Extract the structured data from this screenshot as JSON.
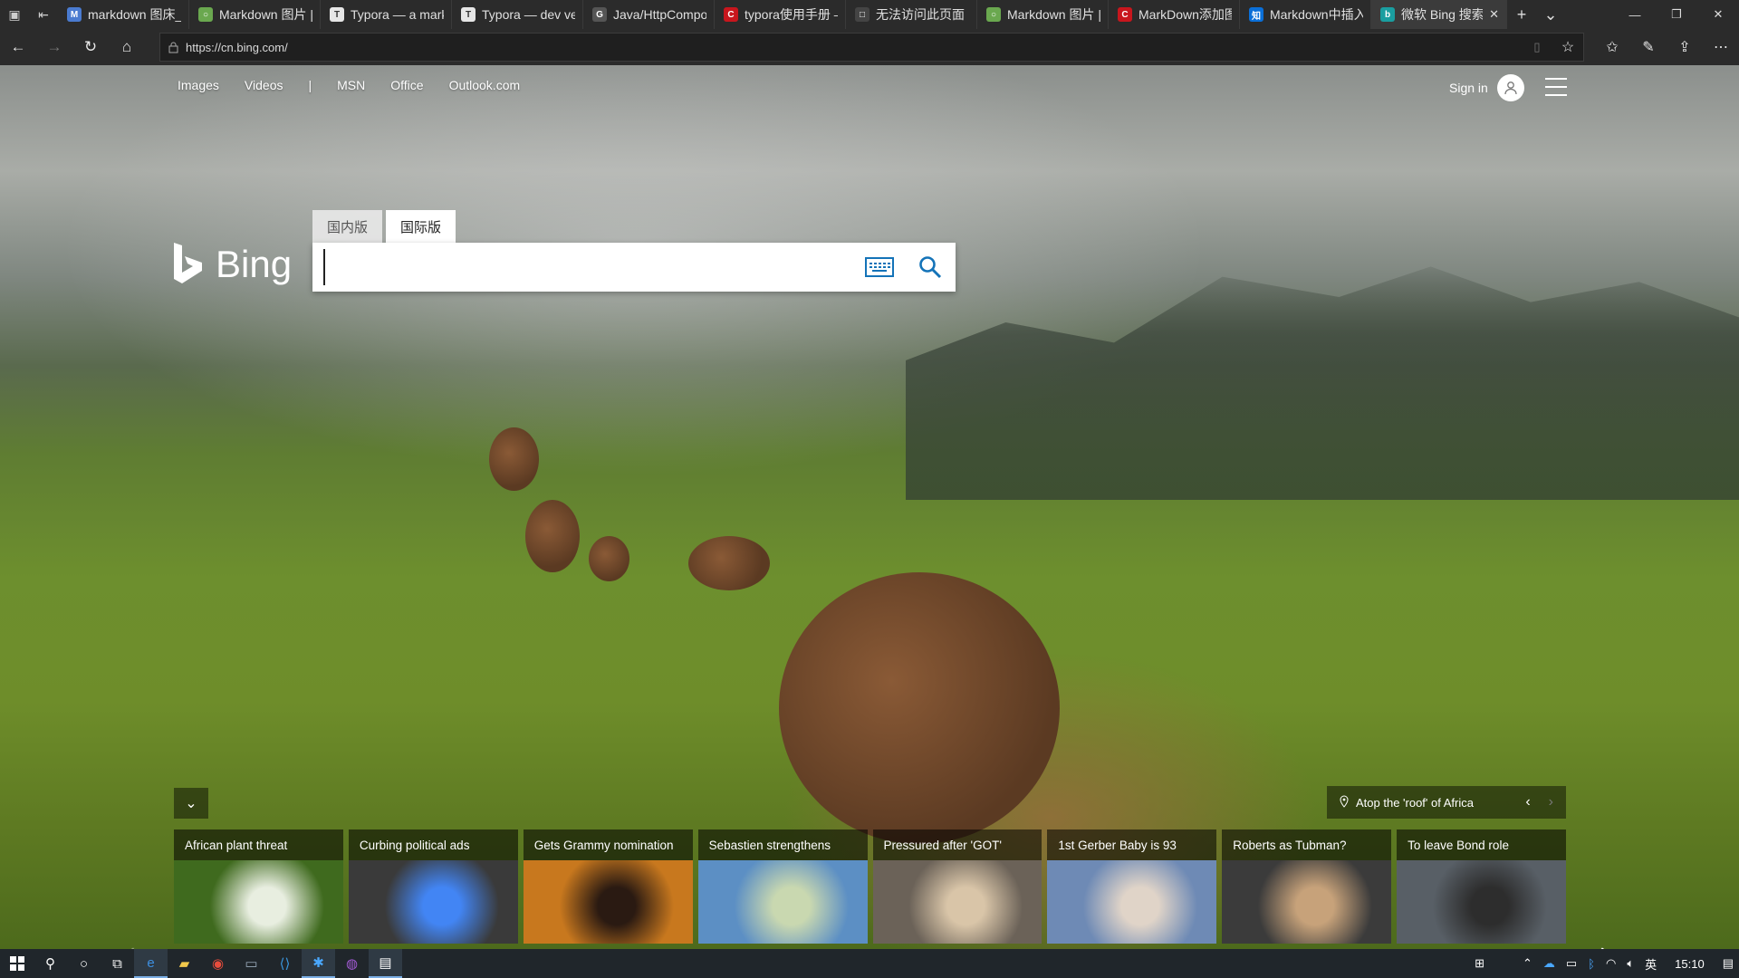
{
  "browser": {
    "tabs": [
      {
        "title": "markdown 图床_B",
        "favicon_color": "#4a7bd0",
        "favicon_char": "M"
      },
      {
        "title": "Markdown 图片 |:",
        "favicon_color": "#6aa84f",
        "favicon_char": "○"
      },
      {
        "title": "Typora — a markc",
        "favicon_color": "#e6e6e6",
        "favicon_char": "T"
      },
      {
        "title": "Typora — dev vers",
        "favicon_color": "#e6e6e6",
        "favicon_char": "T"
      },
      {
        "title": "Java/HttpCompon",
        "favicon_color": "#555555",
        "favicon_char": "G"
      },
      {
        "title": "typora使用手册 —",
        "favicon_color": "#c8161d",
        "favicon_char": "C"
      },
      {
        "title": "无法访问此页面",
        "favicon_color": "#444444",
        "favicon_char": "□"
      },
      {
        "title": "Markdown 图片 |:",
        "favicon_color": "#6aa84f",
        "favicon_char": "○"
      },
      {
        "title": "MarkDown添加图",
        "favicon_color": "#c8161d",
        "favicon_char": "C"
      },
      {
        "title": "Markdown中插入|",
        "favicon_color": "#0a6fd8",
        "favicon_char": "知"
      },
      {
        "title": "微软 Bing 搜索",
        "favicon_color": "#1a9ea0",
        "favicon_char": "b",
        "active": true
      }
    ],
    "url": "https://cn.bing.com/"
  },
  "bing": {
    "nav": [
      "Images",
      "Videos",
      "|",
      "MSN",
      "Office",
      "Outlook.com"
    ],
    "signin": "Sign in",
    "logo_text": "Bing",
    "search_tabs": [
      "国内版",
      "国际版"
    ],
    "search_value": "",
    "location_caption": "Atop the 'roof' of Africa",
    "carousel": [
      {
        "caption": "African plant threat",
        "bg": "#3f6a1e",
        "accent": "#e8eee0"
      },
      {
        "caption": "Curbing political ads",
        "bg": "#3a3a3a",
        "accent": "#4285f4"
      },
      {
        "caption": "Gets Grammy nomination",
        "bg": "#c8781e",
        "accent": "#2a1a12"
      },
      {
        "caption": "Sebastien strengthens",
        "bg": "#5c8fc4",
        "accent": "#c9d8b0"
      },
      {
        "caption": "Pressured after 'GOT'",
        "bg": "#6b6258",
        "accent": "#d9c5a8"
      },
      {
        "caption": "1st Gerber Baby is 93",
        "bg": "#6e8ab5",
        "accent": "#e0d4c8"
      },
      {
        "caption": "Roberts as Tubman?",
        "bg": "#3b3b3b",
        "accent": "#c7a27a"
      },
      {
        "caption": "To leave Bond role",
        "bg": "#585f66",
        "accent": "#2d2d2d"
      }
    ]
  },
  "taskbar": {
    "time": "15:10",
    "ime": "英"
  }
}
